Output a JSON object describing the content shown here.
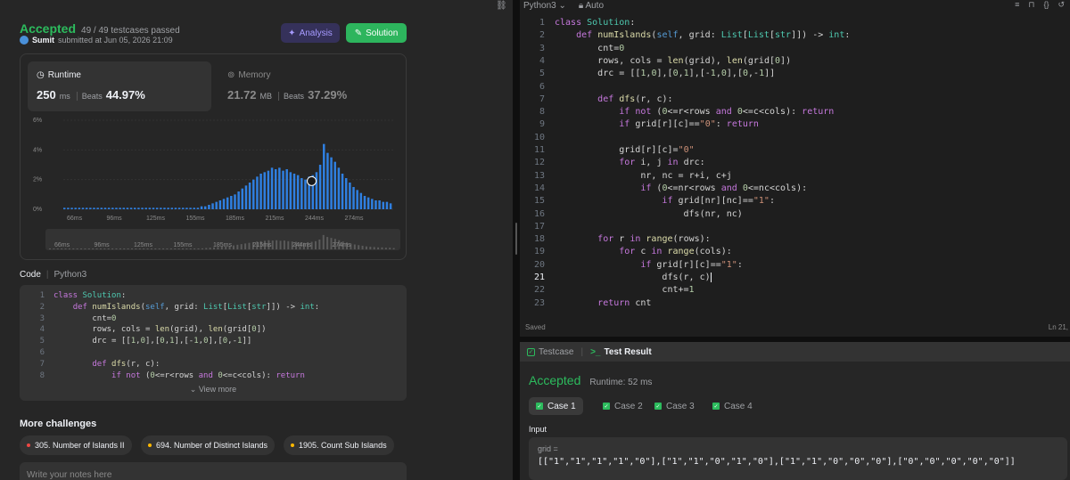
{
  "submission": {
    "status": "Accepted",
    "testcases": "49 / 49 testcases passed",
    "username": "Sumit",
    "submitted_text": "submitted at Jun 05, 2026 21:09",
    "analysis_label": "Analysis",
    "solution_label": "Solution"
  },
  "runtime": {
    "label": "Runtime",
    "value": "250",
    "unit": "ms",
    "beats_label": "Beats",
    "beats_value": "44.97%"
  },
  "memory": {
    "label": "Memory",
    "value": "21.72",
    "unit": "MB",
    "beats_label": "Beats",
    "beats_value": "37.29%"
  },
  "colors": {
    "accent_green": "#2cbb5d",
    "bar_blue": "#2f7fe0",
    "analysis_purple": "#a79bff"
  },
  "chart_data": {
    "type": "bar",
    "y_ticks": [
      "6%",
      "4%",
      "2%",
      "0%"
    ],
    "x_ticks": [
      "66ms",
      "96ms",
      "125ms",
      "155ms",
      "185ms",
      "215ms",
      "244ms",
      "274ms"
    ],
    "ylim": [
      0,
      6
    ],
    "values": [
      0.1,
      0.1,
      0.1,
      0.1,
      0.1,
      0.1,
      0.1,
      0.1,
      0.1,
      0.1,
      0.1,
      0.1,
      0.1,
      0.1,
      0.1,
      0.1,
      0.1,
      0.1,
      0.1,
      0.1,
      0.1,
      0.1,
      0.1,
      0.1,
      0.1,
      0.1,
      0.1,
      0.1,
      0.1,
      0.1,
      0.1,
      0.1,
      0.1,
      0.1,
      0.1,
      0.1,
      0.1,
      0.2,
      0.2,
      0.3,
      0.4,
      0.5,
      0.6,
      0.7,
      0.8,
      0.9,
      1.0,
      1.2,
      1.4,
      1.6,
      1.8,
      2.0,
      2.2,
      2.4,
      2.5,
      2.6,
      2.8,
      2.7,
      2.8,
      2.6,
      2.7,
      2.5,
      2.4,
      2.3,
      2.1,
      2.0,
      2.2,
      2.3,
      2.5,
      3.0,
      4.4,
      3.8,
      3.5,
      3.2,
      2.8,
      2.4,
      2.1,
      1.8,
      1.5,
      1.3,
      1.1,
      0.9,
      0.8,
      0.7,
      0.6,
      0.6,
      0.5,
      0.5,
      0.4
    ],
    "highlight_label": "250ms"
  },
  "code": {
    "header": "Code",
    "language": "Python3",
    "preview_lines": [
      "class Solution:",
      "    def numIslands(self, grid: List[List[str]]) -> int:",
      "        cnt=0",
      "        rows, cols = len(grid), len(grid[0])",
      "        drc = [[1,0],[0,1],[-1,0],[0,-1]]",
      "",
      "        def dfs(r, c):",
      "            if not (0<=r<rows and 0<=c<cols): return"
    ],
    "view_more": "View more"
  },
  "more_challenges": {
    "title": "More challenges",
    "items": [
      {
        "label": "305. Number of Islands II",
        "color": "#ef4743"
      },
      {
        "label": "694. Number of Distinct Islands",
        "color": "#ffb800"
      },
      {
        "label": "1905. Count Sub Islands",
        "color": "#ffb800"
      }
    ]
  },
  "notes": {
    "placeholder": "Write your notes here"
  },
  "editor": {
    "language": "Python3",
    "mode": "Auto",
    "saved": "Saved",
    "cursor_position": "Ln 21,",
    "active_line": 21,
    "lines": [
      "class Solution:",
      "    def numIslands(self, grid: List[List[str]]) -> int:",
      "        cnt=0",
      "        rows, cols = len(grid), len(grid[0])",
      "        drc = [[1,0],[0,1],[-1,0],[0,-1]]",
      "",
      "        def dfs(r, c):",
      "            if not (0<=r<rows and 0<=c<cols): return",
      "            if grid[r][c]==\"0\": return",
      "",
      "            grid[r][c]=\"0\"",
      "            for i, j in drc:",
      "                nr, nc = r+i, c+j",
      "                if (0<=nr<rows and 0<=nc<cols):",
      "                    if grid[nr][nc]==\"1\":",
      "                        dfs(nr, nc)",
      "",
      "        for r in range(rows):",
      "            for c in range(cols):",
      "                if grid[r][c]==\"1\":",
      "                    dfs(r, c)",
      "                    cnt+=1",
      "        return cnt"
    ]
  },
  "test_panel": {
    "tab_testcase": "Testcase",
    "tab_result": "Test Result",
    "status": "Accepted",
    "runtime": "Runtime: 52 ms",
    "cases": [
      "Case 1",
      "Case 2",
      "Case 3",
      "Case 4"
    ],
    "input_label": "Input",
    "input_var": "grid =",
    "input_value": "[[\"1\",\"1\",\"1\",\"1\",\"0\"],[\"1\",\"1\",\"0\",\"1\",\"0\"],[\"1\",\"1\",\"0\",\"0\",\"0\"],[\"0\",\"0\",\"0\",\"0\",\"0\"]]"
  }
}
